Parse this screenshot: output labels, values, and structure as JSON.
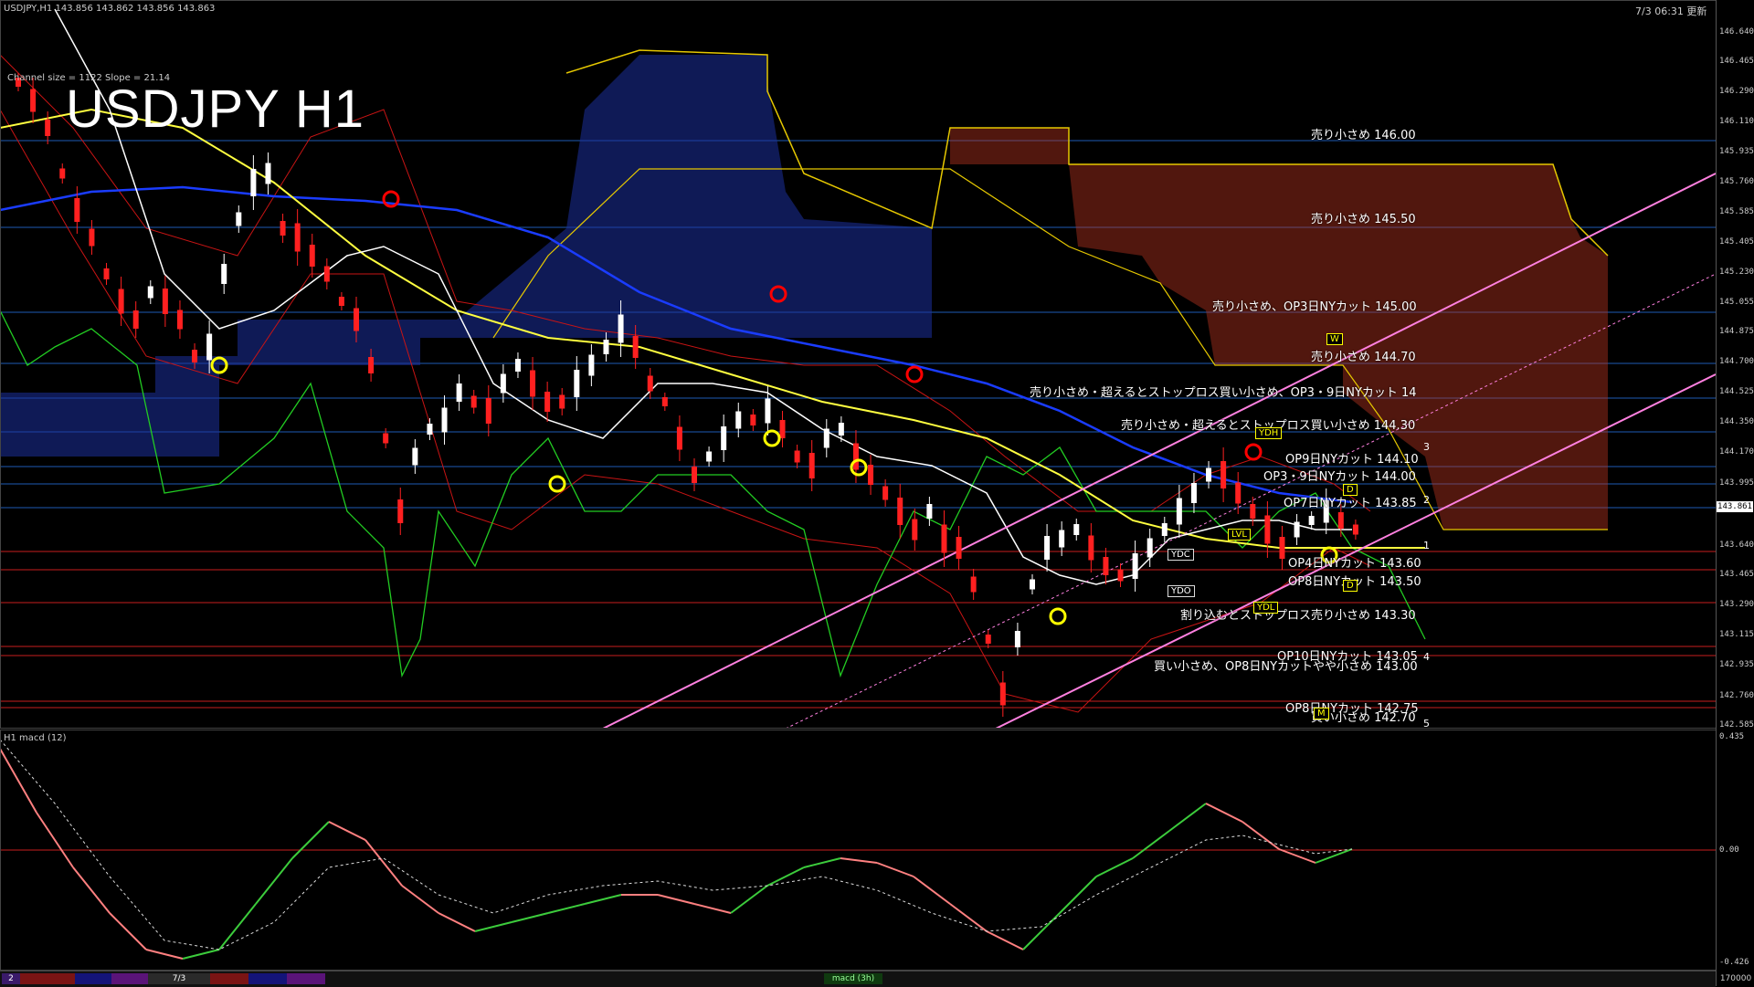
{
  "header": {
    "symbol_info": "USDJPY,H1  143.856  143.862  143.856  143.863",
    "channel_info": "Channel size = 1122 Slope = 21.14",
    "chart_title": "USDJPY H1",
    "datetime": "7/3 06:31 更新"
  },
  "macd_header": "H1  macd (12)",
  "price_axis": [
    "146.640",
    "146.465",
    "146.290",
    "146.110",
    "145.935",
    "145.760",
    "145.585",
    "145.405",
    "145.230",
    "145.055",
    "144.875",
    "144.700",
    "144.525",
    "144.350",
    "144.170",
    "143.995",
    "143.640",
    "143.465",
    "143.290",
    "143.115",
    "142.935",
    "142.760",
    "142.585"
  ],
  "current_price": "143.861",
  "macd_axis": {
    "top": "0.435",
    "zero": "0.00",
    "bottom": "-0.426"
  },
  "levels": [
    {
      "text": "売り小さめ 146.00",
      "color": "#1e5ab4"
    },
    {
      "text": "売り小さめ 145.50",
      "color": "#1e5ab4"
    },
    {
      "text": "売り小さめ、OP3日NYカット 145.00",
      "color": "#1e5ab4"
    },
    {
      "text": "売り小さめ 144.70",
      "color": "#1e5ab4"
    },
    {
      "text": "売り小さめ・超えるとストップロス買い小さめ、OP3・9日NYカット 14",
      "color": "#1e5ab4"
    },
    {
      "text": "売り小さめ・超えるとストップロス買い小さめ 144.30",
      "color": "#1e5ab4"
    },
    {
      "text": "OP9日NYカット 144.10",
      "color": "#1e5ab4"
    },
    {
      "text": "OP3・9日NYカット 144.00",
      "color": "#1e5ab4"
    },
    {
      "text": "OP7日NYカット 143.85",
      "color": "#1e5ab4"
    },
    {
      "text": "OP4日NYカット 143.60",
      "color": "#c81e1e"
    },
    {
      "text": "OP8日NYカット 143.50",
      "color": "#c81e1e"
    },
    {
      "text": "割り込むとストップロス売り小さめ 143.30",
      "color": "#c81e1e"
    },
    {
      "text": "OP10日NYカット 143.05",
      "color": "#c81e1e"
    },
    {
      "text": "買い小さめ、OP8日NYカットやや小さめ 143.00",
      "color": "#c81e1e"
    },
    {
      "text": "OP8日NYカット 142.75",
      "color": "#c81e1e"
    },
    {
      "text": "買い小さめ 142.70",
      "color": "#c81e1e"
    }
  ],
  "channel_numbers": [
    "3",
    "2",
    "1",
    "4",
    "5"
  ],
  "tags": {
    "ydh": "YDH",
    "ydc": "YDC",
    "ydo": "YDO",
    "ydl": "YDL",
    "lvl": "LVL",
    "w": "W",
    "m": "M",
    "d": "D"
  },
  "bottom_tabs": [
    "2",
    "7/3"
  ],
  "bottom_center": "macd (3h)",
  "bottom_right": "170000",
  "colors": {
    "up": "#ffffff",
    "down": "#ff2020",
    "ma_short": "#ffffff",
    "ma_mid": "#ffff40",
    "ma_long": "#1a3cff",
    "chikou": "#22cc22",
    "bb": "#c81414",
    "kumo_blue": "#1c2f9c",
    "kumo_red": "#b4321e",
    "channel": "#ff80e0",
    "macd_pos": "#3ccc3c",
    "macd_neg": "#ff8080"
  }
}
